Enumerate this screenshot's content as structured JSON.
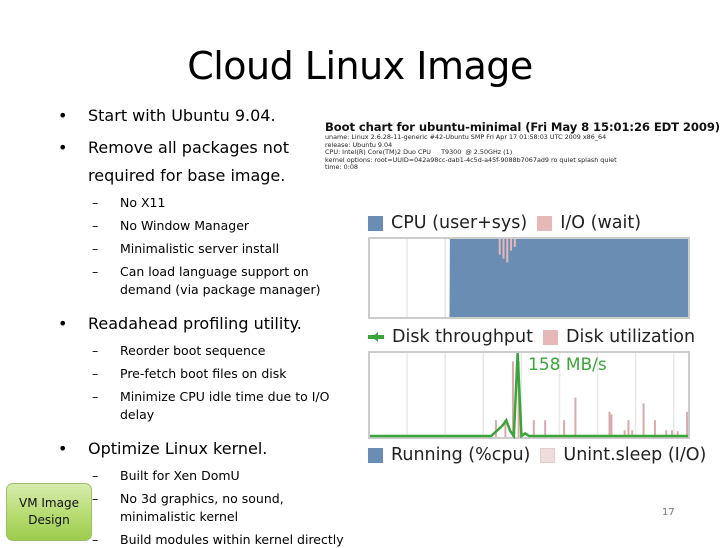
{
  "slide": {
    "title": "Cloud Linux Image",
    "page_number": "17",
    "side_label": {
      "line1": "VM Image",
      "line2": "Design"
    },
    "bullets": [
      {
        "text": "Start with Ubuntu 9.04.",
        "subs": []
      },
      {
        "text": "Remove all packages not",
        "text2": "required for base image.",
        "subs": [
          "No X11",
          "No Window Manager",
          "Minimalistic server install",
          "Can load language support on",
          "demand (via package manager)"
        ]
      },
      {
        "text": "Readahead profiling utility.",
        "subs": [
          "Reorder boot sequence",
          "Pre-fetch boot files on disk",
          "Minimize CPU idle time due to I/O",
          "delay"
        ]
      },
      {
        "text": "Optimize Linux kernel.",
        "subs": [
          "Built for Xen DomU",
          "No 3d graphics, no sound,",
          "minimalistic kernel",
          "Build modules within kernel directly"
        ]
      }
    ],
    "bullet_glyph": "•",
    "dash_glyph": "–"
  },
  "bootchart": {
    "title": "Boot chart for ubuntu-minimal (Fri May  8 15:01:26 EDT 2009)",
    "meta": [
      "uname: Linux 2.6.28-11-generic #42-Ubuntu SMP Fri Apr 17 01:58:03 UTC 2009 x86_64",
      "release: Ubuntu 9.04",
      "CPU: Intel(R) Core(TM)2 Duo CPU     T9300  @ 2.50GHz (1)",
      "kernel options: root=UUID=042a98cc-dab1-4c5d-a45f-9088b7067ad9 ro quiet splash quiet",
      "time: 0:08"
    ],
    "colors": {
      "cpu": "#6a8db3",
      "io": "#e6b8b8",
      "disk_line": "#3aa63a",
      "disk_util": "#d9aaaa",
      "unint": "#efdcdc",
      "grid": "#e8e8e8",
      "border": "#cccccc"
    },
    "legends": {
      "cpu": "CPU (user+sys)",
      "io": "I/O (wait)",
      "throughput": "Disk throughput",
      "utilization": "Disk utilization",
      "running": "Running (%cpu)",
      "unint": "Unint.sleep (I/O)"
    }
  },
  "chart_data": [
    {
      "type": "area",
      "title": "CPU (user+sys) / I/O (wait)",
      "x_unit": "seconds",
      "xlim": [
        0,
        8.4
      ],
      "ylim": [
        0,
        100
      ],
      "series": [
        {
          "name": "CPU (user+sys)",
          "x": [
            0,
            2.1,
            2.11,
            8.4
          ],
          "values": [
            0,
            0,
            100,
            100
          ]
        },
        {
          "name": "I/O (wait)",
          "x": [
            3.4,
            3.5,
            3.6,
            3.7,
            3.8
          ],
          "values": [
            20,
            25,
            30,
            15,
            10
          ]
        }
      ]
    },
    {
      "type": "bar+line",
      "title": "Disk throughput / Disk utilization",
      "x_unit": "seconds",
      "xlim": [
        0,
        8.4
      ],
      "annotation": "158 MB/s",
      "series": [
        {
          "name": "Disk utilization (%)",
          "x": [
            3.3,
            3.55,
            3.75,
            3.9,
            4.3,
            4.6,
            5.1,
            5.4,
            6.3,
            6.35,
            6.7,
            6.8,
            6.9,
            7.2,
            7.5,
            7.8,
            7.95,
            8.1,
            8.35
          ],
          "values": [
            20,
            20,
            90,
            90,
            20,
            20,
            20,
            47,
            30,
            27,
            8,
            20,
            8,
            40,
            20,
            8,
            8,
            7,
            30
          ]
        },
        {
          "name": "Disk throughput (MB/s)",
          "x": [
            0,
            2.1,
            3.2,
            3.5,
            3.6,
            3.7,
            3.8,
            3.9,
            4.0,
            4.1,
            4.2,
            8.4
          ],
          "values": [
            0,
            0,
            0,
            20,
            30,
            10,
            0,
            158,
            0,
            5,
            0,
            0
          ]
        }
      ]
    }
  ]
}
